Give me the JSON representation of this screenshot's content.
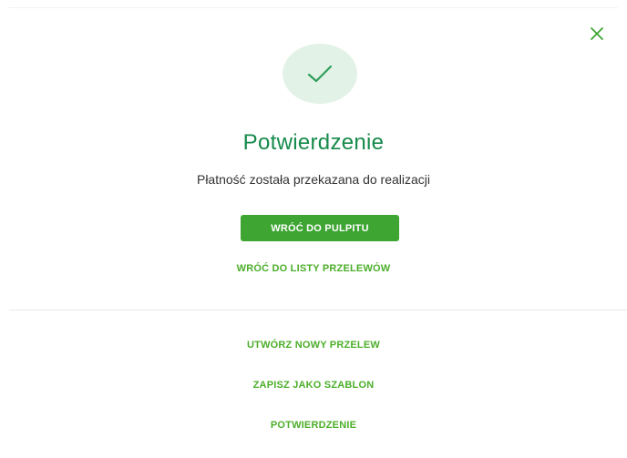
{
  "dialog": {
    "close_label": "Zamknij",
    "title": "Potwierdzenie",
    "message": "Płatność została przekazana do realizacji",
    "primary_button": "WRÓĆ DO PULPITU",
    "secondary_link": "WRÓĆ DO LISTY PRZELEWÓW"
  },
  "actions": [
    "UTWÓRZ NOWY PRZELEW",
    "ZAPISZ JAKO SZABLON",
    "POTWIERDZENIE"
  ],
  "icons": {
    "close": "close-icon",
    "success": "checkmark-icon"
  },
  "colors": {
    "title": "#168a4a",
    "primary_button": "#3ea533",
    "link": "#4cae2a",
    "success_circle": "#e3f2e7",
    "check": "#2e9e5a"
  }
}
